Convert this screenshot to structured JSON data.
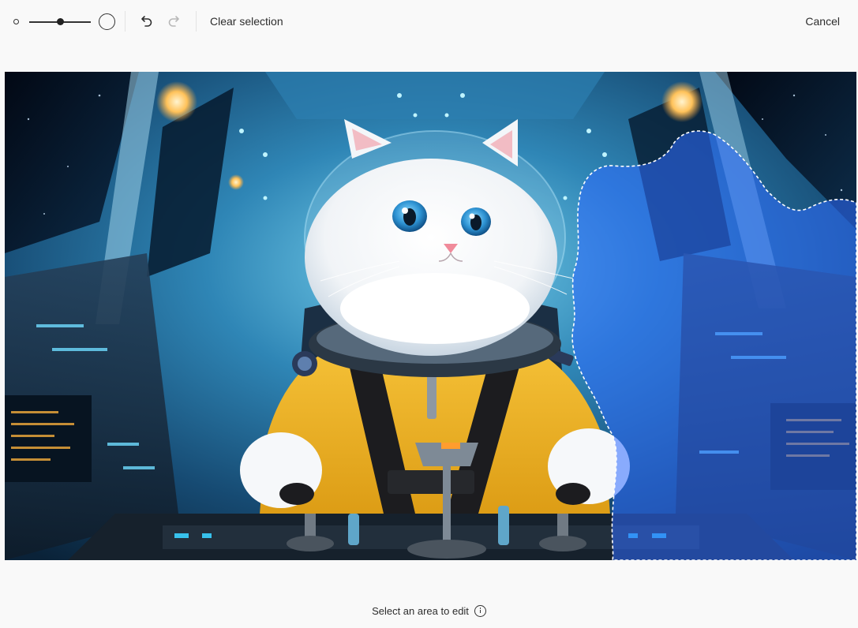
{
  "toolbar": {
    "brush_size": 0.5,
    "clear_selection_label": "Clear selection",
    "cancel_label": "Cancel",
    "icons": {
      "brush_small": "small-circle-icon",
      "brush_large": "large-circle-icon",
      "undo": "undo-icon",
      "redo": "redo-icon"
    },
    "redo_enabled": false
  },
  "canvas": {
    "image_subject": "white cat in yellow astronaut suit in spaceship cockpit",
    "selection_color": "#2f6bff"
  },
  "footer": {
    "hint": "Select an area to edit",
    "info_icon": "info-icon"
  },
  "colors": {
    "background": "#f9f9f9",
    "text": "#2d2d2d",
    "icon_disabled": "#b8b8b8"
  }
}
